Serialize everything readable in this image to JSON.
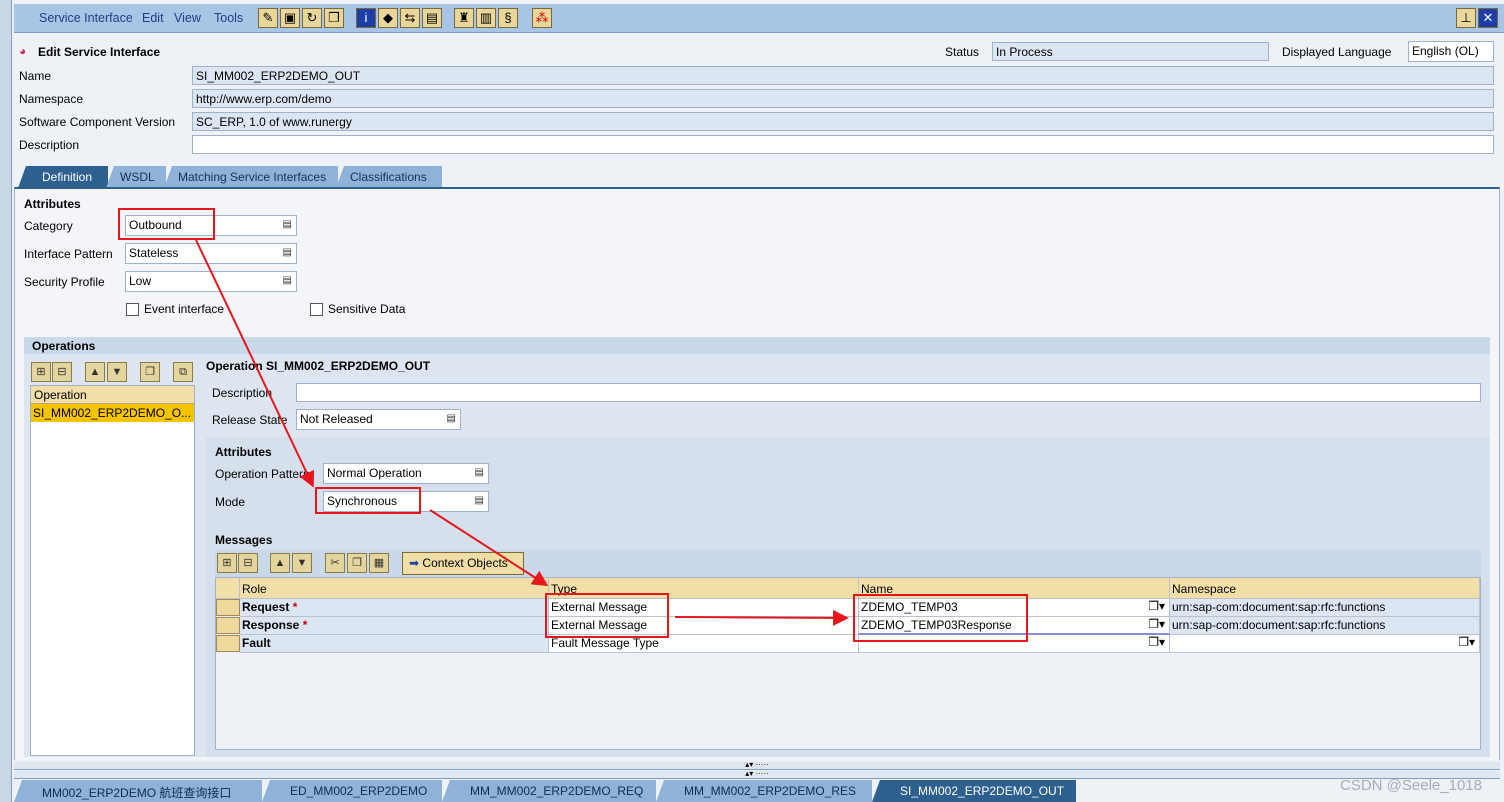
{
  "menu": [
    "Service Interface",
    "Edit",
    "View",
    "Tools"
  ],
  "toolbar_icons": [
    "edit-icon",
    "save-icon",
    "refresh-icon",
    "copy-icon",
    "info-icon",
    "erase-icon",
    "where-used-icon",
    "compare-icon",
    "hat-icon",
    "book-icon",
    "scroll-icon",
    "network-icon"
  ],
  "header": {
    "title": "Edit Service Interface",
    "status_label": "Status",
    "status_value": "In Process",
    "lang_label": "Displayed Language",
    "lang_value": "English (OL)"
  },
  "fields": [
    {
      "label": "Name",
      "value": "SI_MM002_ERP2DEMO_OUT"
    },
    {
      "label": "Namespace",
      "value": "http://www.erp.com/demo"
    },
    {
      "label": "Software Component Version",
      "value": "SC_ERP, 1.0 of www.runergy"
    },
    {
      "label": "Description",
      "value": ""
    }
  ],
  "tabs": [
    "Definition",
    "WSDL",
    "Matching Service Interfaces",
    "Classifications"
  ],
  "attributes": {
    "title": "Attributes",
    "rows": [
      {
        "label": "Category",
        "value": "Outbound"
      },
      {
        "label": "Interface Pattern",
        "value": "Stateless"
      },
      {
        "label": "Security Profile",
        "value": "Low"
      }
    ],
    "event_interface": "Event interface",
    "sensitive_data": "Sensitive Data"
  },
  "operations": {
    "title": "Operations",
    "col": "Operation",
    "items": [
      "SI_MM002_ERP2DEMO_O..."
    ],
    "detail_title": "Operation SI_MM002_ERP2DEMO_OUT",
    "description_label": "Description",
    "release_label": "Release State",
    "release_value": "Not Released",
    "attr_title": "Attributes",
    "pattern_label": "Operation Pattern",
    "pattern_value": "Normal Operation",
    "mode_label": "Mode",
    "mode_value": "Synchronous"
  },
  "messages": {
    "title": "Messages",
    "context_button": "Context Objects",
    "columns": [
      "Role",
      "Type",
      "Name",
      "Namespace"
    ],
    "rows": [
      {
        "role": "Request",
        "req": "*",
        "type": "External Message",
        "name": "ZDEMO_TEMP03",
        "ns": "urn:sap-com:document:sap:rfc:functions"
      },
      {
        "role": "Response",
        "req": "*",
        "type": "External Message",
        "name": "ZDEMO_TEMP03Response",
        "ns": "urn:sap-com:document:sap:rfc:functions"
      },
      {
        "role": "Fault",
        "req": "",
        "type": "Fault Message Type",
        "name": "",
        "ns": ""
      }
    ]
  },
  "bottom_tabs": [
    "MM002_ERP2DEMO 航班查询接口",
    "ED_MM002_ERP2DEMO",
    "MM_MM002_ERP2DEMO_REQ",
    "MM_MM002_ERP2DEMO_RES",
    "SI_MM002_ERP2DEMO_OUT"
  ],
  "watermark": "CSDN @Seele_1018",
  "colors": {
    "annotation": "#e5161c",
    "active_tab": "#2d5f8f",
    "toolbar": "#a9c5e6"
  }
}
